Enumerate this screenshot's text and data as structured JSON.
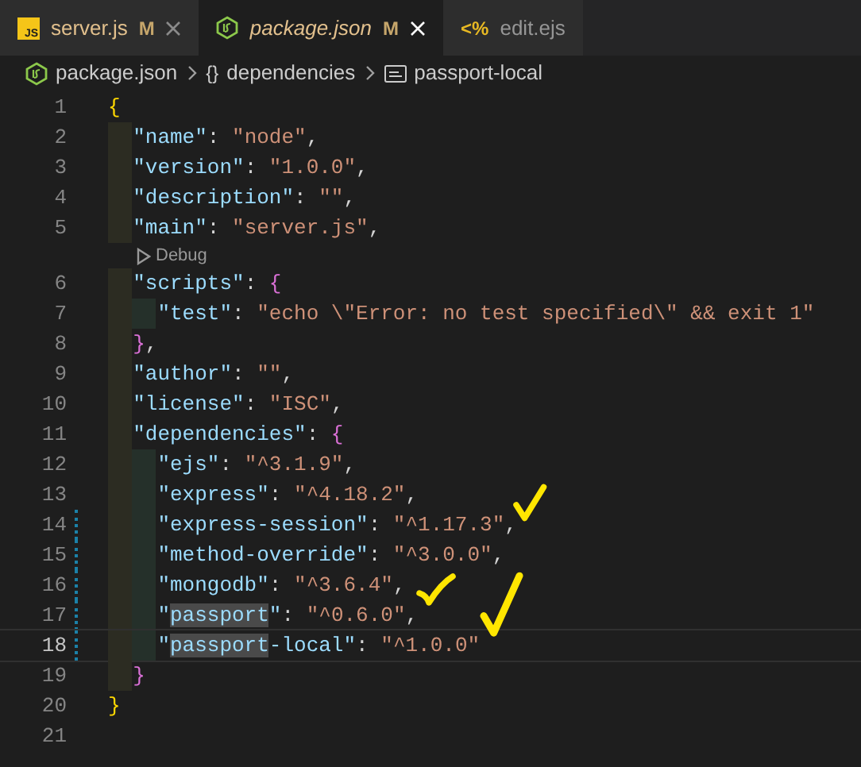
{
  "tabs": [
    {
      "label": "server.js",
      "kind": "js",
      "icon_text": "JS",
      "badge": "M",
      "selected": false,
      "italic": false,
      "close": true
    },
    {
      "label": "package.json",
      "kind": "node",
      "badge": "M",
      "selected": true,
      "italic": true,
      "close": true
    },
    {
      "label": "edit.ejs",
      "kind": "ejs",
      "icon_text": "<%",
      "selected": false,
      "italic": false,
      "close": false
    }
  ],
  "breadcrumbs": [
    {
      "kind": "node",
      "label": "package.json"
    },
    {
      "kind": "braces",
      "icon_text": "{}",
      "label": "dependencies"
    },
    {
      "kind": "string",
      "label": "passport-local"
    }
  ],
  "lines": [
    {
      "kind": "code",
      "number": "1",
      "tokens": [
        {
          "kind": "brace1",
          "text": "{"
        }
      ]
    },
    {
      "kind": "code",
      "number": "2",
      "tokens": [
        {
          "kind": "key",
          "text": "  \"name\""
        },
        {
          "kind": "punct",
          "text": ": "
        },
        {
          "kind": "string",
          "text": "\"node\""
        },
        {
          "kind": "punct",
          "text": ","
        }
      ]
    },
    {
      "kind": "code",
      "number": "3",
      "tokens": [
        {
          "kind": "key",
          "text": "  \"version\""
        },
        {
          "kind": "punct",
          "text": ": "
        },
        {
          "kind": "string",
          "text": "\"1.0.0\""
        },
        {
          "kind": "punct",
          "text": ","
        }
      ]
    },
    {
      "kind": "code",
      "number": "4",
      "tokens": [
        {
          "kind": "key",
          "text": "  \"description\""
        },
        {
          "kind": "punct",
          "text": ": "
        },
        {
          "kind": "string",
          "text": "\"\""
        },
        {
          "kind": "punct",
          "text": ","
        }
      ]
    },
    {
      "kind": "code",
      "number": "5",
      "tokens": [
        {
          "kind": "key",
          "text": "  \"main\""
        },
        {
          "kind": "punct",
          "text": ": "
        },
        {
          "kind": "string",
          "text": "\"server.js\""
        },
        {
          "kind": "punct",
          "text": ","
        }
      ]
    },
    {
      "kind": "codelens",
      "label": "Debug"
    },
    {
      "kind": "code",
      "number": "6",
      "tokens": [
        {
          "kind": "key",
          "text": "  \"scripts\""
        },
        {
          "kind": "punct",
          "text": ": "
        },
        {
          "kind": "brace2",
          "text": "{"
        }
      ]
    },
    {
      "kind": "code",
      "number": "7",
      "tokens": [
        {
          "kind": "key",
          "text": "    \"test\""
        },
        {
          "kind": "punct",
          "text": ": "
        },
        {
          "kind": "string",
          "text": "\"echo \\\"Error: no test specified\\\" && exit 1\""
        }
      ]
    },
    {
      "kind": "code",
      "number": "8",
      "tokens": [
        {
          "kind": "brace2",
          "text": "  }"
        },
        {
          "kind": "punct",
          "text": ","
        }
      ]
    },
    {
      "kind": "code",
      "number": "9",
      "tokens": [
        {
          "kind": "key",
          "text": "  \"author\""
        },
        {
          "kind": "punct",
          "text": ": "
        },
        {
          "kind": "string",
          "text": "\"\""
        },
        {
          "kind": "punct",
          "text": ","
        }
      ]
    },
    {
      "kind": "code",
      "number": "10",
      "tokens": [
        {
          "kind": "key",
          "text": "  \"license\""
        },
        {
          "kind": "punct",
          "text": ": "
        },
        {
          "kind": "string",
          "text": "\"ISC\""
        },
        {
          "kind": "punct",
          "text": ","
        }
      ]
    },
    {
      "kind": "code",
      "number": "11",
      "tokens": [
        {
          "kind": "key",
          "text": "  \"dependencies\""
        },
        {
          "kind": "punct",
          "text": ": "
        },
        {
          "kind": "brace2",
          "text": "{"
        }
      ]
    },
    {
      "kind": "code",
      "number": "12",
      "tokens": [
        {
          "kind": "key",
          "text": "    \"ejs\""
        },
        {
          "kind": "punct",
          "text": ": "
        },
        {
          "kind": "string",
          "text": "\"^3.1.9\""
        },
        {
          "kind": "punct",
          "text": ","
        }
      ]
    },
    {
      "kind": "code",
      "number": "13",
      "tokens": [
        {
          "kind": "key",
          "text": "    \"express\""
        },
        {
          "kind": "punct",
          "text": ": "
        },
        {
          "kind": "string",
          "text": "\"^4.18.2\""
        },
        {
          "kind": "punct",
          "text": ","
        }
      ]
    },
    {
      "kind": "code",
      "number": "14",
      "modified": true,
      "tokens": [
        {
          "kind": "key",
          "text": "    \"express-session\""
        },
        {
          "kind": "punct",
          "text": ": "
        },
        {
          "kind": "string",
          "text": "\"^1.17.3\""
        },
        {
          "kind": "punct",
          "text": ","
        }
      ]
    },
    {
      "kind": "code",
      "number": "15",
      "modified": true,
      "tokens": [
        {
          "kind": "key",
          "text": "    \"method-override\""
        },
        {
          "kind": "punct",
          "text": ": "
        },
        {
          "kind": "string",
          "text": "\"^3.0.0\""
        },
        {
          "kind": "punct",
          "text": ","
        }
      ]
    },
    {
      "kind": "code",
      "number": "16",
      "modified": true,
      "tokens": [
        {
          "kind": "key",
          "text": "    \"mongodb\""
        },
        {
          "kind": "punct",
          "text": ": "
        },
        {
          "kind": "string",
          "text": "\"^3.6.4\""
        },
        {
          "kind": "punct",
          "text": ","
        }
      ]
    },
    {
      "kind": "code",
      "number": "17",
      "modified": true,
      "tokens": [
        {
          "kind": "key",
          "text": "    \""
        },
        {
          "kind": "key",
          "highlight": true,
          "text": "passport"
        },
        {
          "kind": "key",
          "text": "\""
        },
        {
          "kind": "punct",
          "text": ": "
        },
        {
          "kind": "string",
          "text": "\"^0.6.0\""
        },
        {
          "kind": "punct",
          "text": ","
        }
      ]
    },
    {
      "kind": "code",
      "number": "18",
      "modified": true,
      "current": true,
      "tokens": [
        {
          "kind": "key",
          "text": "    \""
        },
        {
          "kind": "key",
          "highlight": true,
          "text": "passport"
        },
        {
          "kind": "key",
          "text": "-local\""
        },
        {
          "kind": "punct",
          "text": ": "
        },
        {
          "kind": "string",
          "text": "\"^1.0.0\""
        }
      ]
    },
    {
      "kind": "code",
      "number": "19",
      "tokens": [
        {
          "kind": "brace2",
          "text": "  }"
        }
      ]
    },
    {
      "kind": "code",
      "number": "20",
      "tokens": [
        {
          "kind": "brace1",
          "text": "}"
        }
      ]
    },
    {
      "kind": "code",
      "number": "21"
    }
  ]
}
